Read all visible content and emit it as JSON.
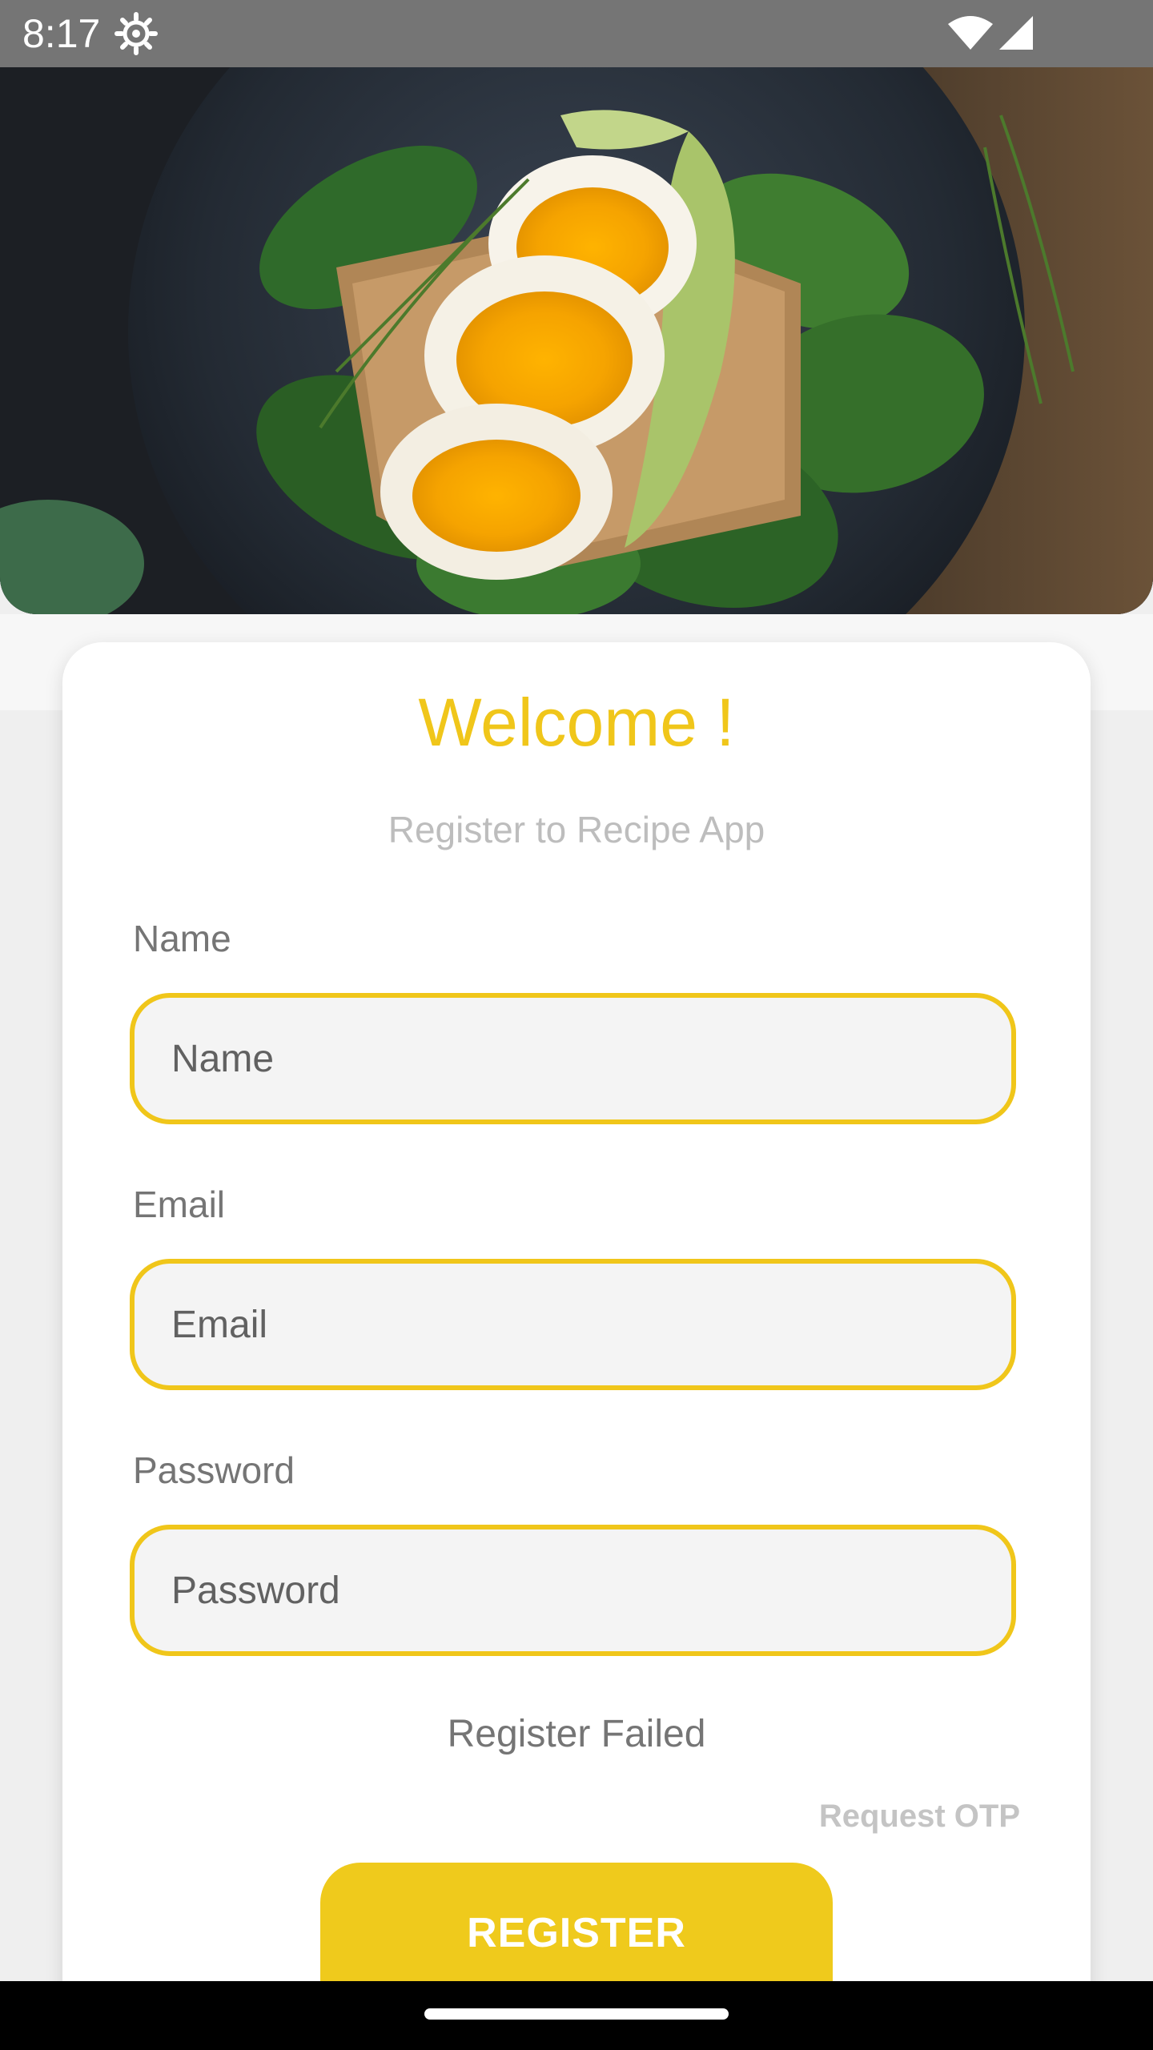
{
  "status_bar": {
    "time": "8:17",
    "icons": [
      "gear-icon",
      "wifi-icon",
      "signal-icon"
    ]
  },
  "hero": {
    "image": "egg-toast-photo"
  },
  "card": {
    "welcome": "Welcome !",
    "subtitle": "Register to Recipe App",
    "fields": [
      {
        "label": "Name",
        "placeholder": "Name",
        "value": ""
      },
      {
        "label": "Email",
        "placeholder": "Email",
        "value": ""
      },
      {
        "label": "Password",
        "placeholder": "Password",
        "value": ""
      }
    ],
    "status_message": "Register Failed",
    "request_otp": "Request OTP",
    "register_button": "REGISTER"
  },
  "colors": {
    "accent": "#f0c61a",
    "status_bar": "#757575",
    "field_bg": "#f4f4f4",
    "nav_bar": "#000000"
  }
}
